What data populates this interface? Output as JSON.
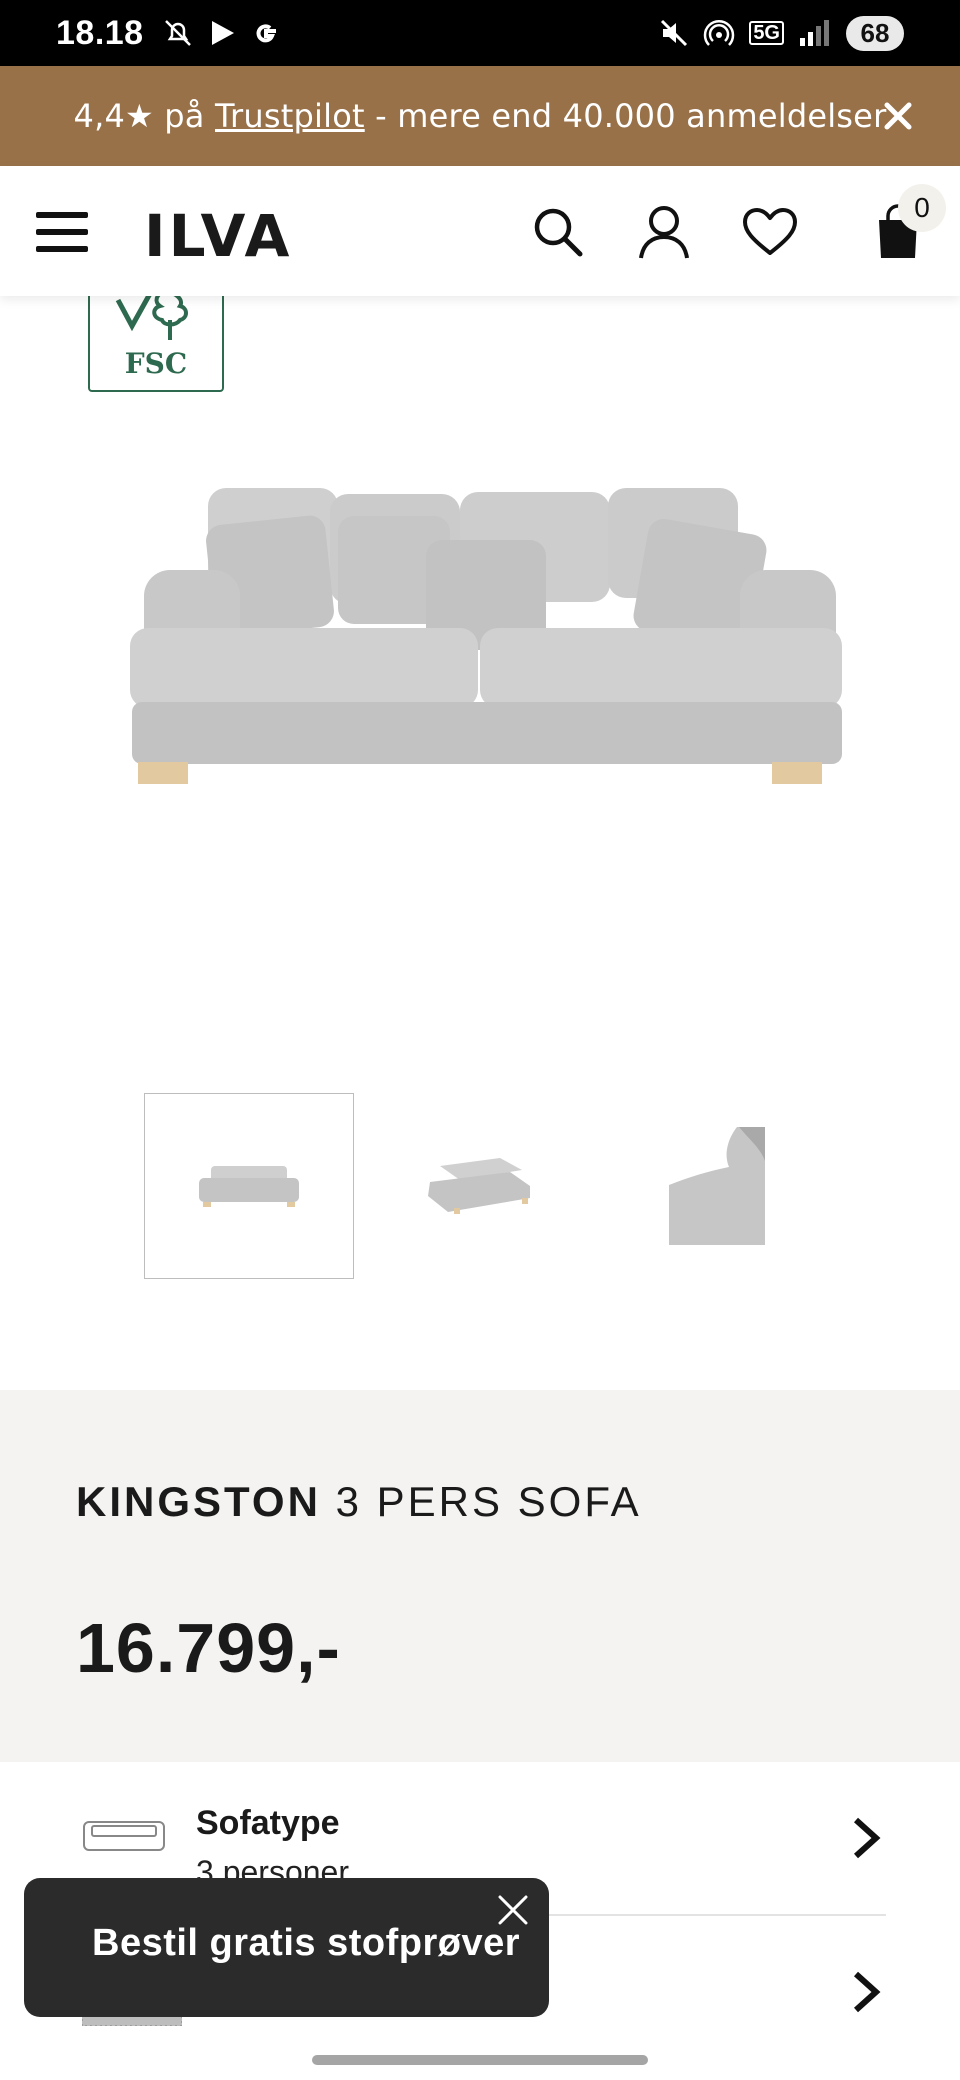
{
  "status_bar": {
    "time": "18.18",
    "network": "5G",
    "battery": "68"
  },
  "promo": {
    "rating": "4,4★ på",
    "link_text": "Trustpilot",
    "suffix": "- mere end 40.000 anmeldelser"
  },
  "header": {
    "logo": "ILVA",
    "cart_count": "0"
  },
  "badge": {
    "text": "FSC"
  },
  "product": {
    "brand": "KINGSTON",
    "name": "3 PERS SOFA",
    "price": "16.799,-"
  },
  "options": [
    {
      "title": "Sofatype",
      "value": "3 personer"
    },
    {
      "title": "",
      "value": ""
    }
  ],
  "toast": {
    "text": "Bestil gratis stofprøver"
  },
  "colors": {
    "banner": "#987149",
    "fsc_green": "#2e6a4f",
    "info_bg": "#f4f3f1",
    "toast_bg": "#2b2b2b"
  },
  "icons": [
    "hamburger-icon",
    "search-icon",
    "account-icon",
    "heart-icon",
    "cart-icon",
    "close-icon",
    "chevron-right-icon",
    "sofa-icon"
  ]
}
